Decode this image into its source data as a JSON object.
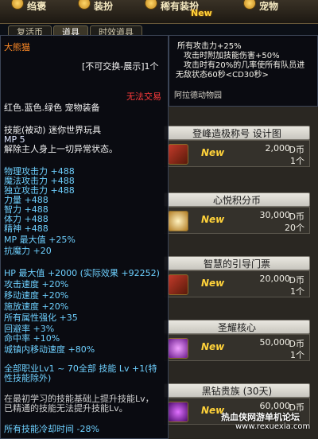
{
  "topnav": {
    "items": [
      {
        "label": "绉褒"
      },
      {
        "label": "装扮"
      },
      {
        "label": "稀有装扮"
      },
      {
        "label": "宠物"
      }
    ],
    "new_badge": "New"
  },
  "tabs": [
    {
      "label": "复活币"
    },
    {
      "label": "道具"
    },
    {
      "label": "时效道具"
    }
  ],
  "shop": {
    "rows": [
      {
        "title": "登峰造极称号 设计图",
        "new": "New",
        "price": "2,000",
        "unit": "D币",
        "qty": "1个"
      },
      {
        "title": "心悦积分币",
        "new": "New",
        "price": "30,000",
        "unit": "D币",
        "qty": "20个"
      },
      {
        "title": "智慧的引导门票",
        "new": "New",
        "price": "20,000",
        "unit": "D币",
        "qty": "1个"
      },
      {
        "title": "圣耀核心",
        "new": "New",
        "price": "50,000",
        "unit": "D币",
        "qty": "1个"
      },
      {
        "title": "黑钻贵族 (30天)",
        "new": "New",
        "price": "60,000",
        "unit": "D币",
        "qty": ""
      }
    ]
  },
  "tooltip": {
    "name": "大熊猫",
    "trade": "[不可交换-展示]1个",
    "untradable": "无法交易",
    "category": "红色.蓝色.绿色 宠物装备",
    "skill_name": "技能(被动) 迷你世界玩具",
    "mp": "MP 5",
    "skill_desc": "解除主人身上一切异常状态。",
    "stats": [
      "物理攻击力 +488",
      "魔法攻击力 +488",
      "独立攻击力 +488",
      "力量 +488",
      "智力 +488",
      "体力 +488",
      "精神 +488",
      "MP 最大值 +25%",
      "抗魔力 +20"
    ],
    "stats2": [
      "HP 最大值 +2000 (实际效果 +92252)",
      "攻击速度 +20%",
      "移动速度 +20%",
      "施放速度 +20%",
      "所有属性强化 +35",
      "回避率 +3%",
      "命中率 +10%",
      "城镇内移动速度 +80%"
    ],
    "skill_level_1": "全部职业Lv1 ~ 70全部 技能 Lv +1(特",
    "skill_level_2": "性技能除外)",
    "note_1": "在最初学习的技能基础上提升技能Lv，",
    "note_2": "已精通的技能无法提升技能Lv。",
    "cooldown": "所有技能冷却时间 -28%"
  },
  "tooltip2": {
    "lines": [
      "所有攻击力+25%",
      "攻击时附加技能伤害+50%",
      "攻击时有20%的几率使所有队员进",
      "无敌状态60秒<CD30秒>"
    ],
    "footer": "阿拉德动物园"
  },
  "watermark": {
    "title": "热血侠网游单机论坛",
    "url": "www.rexuexia.com"
  }
}
